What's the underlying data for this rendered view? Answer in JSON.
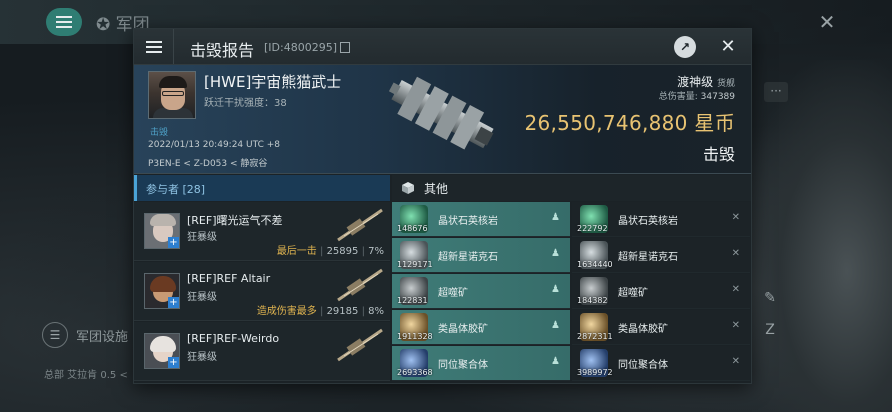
{
  "background": {
    "title": "军团",
    "left_item_label": "军团设施",
    "bottom_text": "总部 艾拉肯 0.5 <"
  },
  "dialog": {
    "title": "击毁报告",
    "report_id": "[ID:4800295]"
  },
  "victim": {
    "name": "[HWE]宇宙熊猫武士",
    "warp_scramble": "跃迁干扰强度：38",
    "role": "击毁",
    "time": "2022/01/13 20:49:24 UTC +8",
    "location": "P3EN-E < Z-D053 < 静寂谷",
    "ship_class": "渡神级",
    "ship_type": "货舰",
    "damage_label": "总伤害量:",
    "damage_value": "347389",
    "isk_value": "26,550,746,880",
    "isk_unit": "星币",
    "status": "击毁"
  },
  "participants": {
    "header": "参与者 [28]",
    "rows": [
      {
        "name": "[REF]曙光运气不差",
        "ship": "狂暴级",
        "tag": "最后一击",
        "damage": "25895",
        "percent": "7%"
      },
      {
        "name": "[REF]REF Altair",
        "ship": "狂暴级",
        "tag": "造成伤害最多",
        "damage": "29185",
        "percent": "8%"
      },
      {
        "name": "[REF]REF-Weirdo",
        "ship": "狂暴级",
        "tag": "",
        "damage": "",
        "percent": ""
      }
    ]
  },
  "other": {
    "header": "其他",
    "items": [
      {
        "name": "晶状石英核岩",
        "qty": "148676",
        "state": "dropped"
      },
      {
        "name": "晶状石英核岩",
        "qty": "222792",
        "state": "destroyed"
      },
      {
        "name": "超新星诺克石",
        "qty": "1129171",
        "state": "dropped"
      },
      {
        "name": "超新星诺克石",
        "qty": "1634440",
        "state": "destroyed"
      },
      {
        "name": "超噬矿",
        "qty": "122831",
        "state": "dropped"
      },
      {
        "name": "超噬矿",
        "qty": "184382",
        "state": "destroyed"
      },
      {
        "name": "类晶体胶矿",
        "qty": "1911328",
        "state": "dropped"
      },
      {
        "name": "类晶体胶矿",
        "qty": "2872311",
        "state": "destroyed"
      },
      {
        "name": "同位聚合体",
        "qty": "2693368",
        "state": "dropped"
      },
      {
        "name": "同位聚合体",
        "qty": "3989972",
        "state": "destroyed"
      }
    ]
  },
  "colors": {
    "accent_teal": "#3f7c78",
    "isk_gold": "#e8c372",
    "participants_blue": "#1a3a55"
  }
}
